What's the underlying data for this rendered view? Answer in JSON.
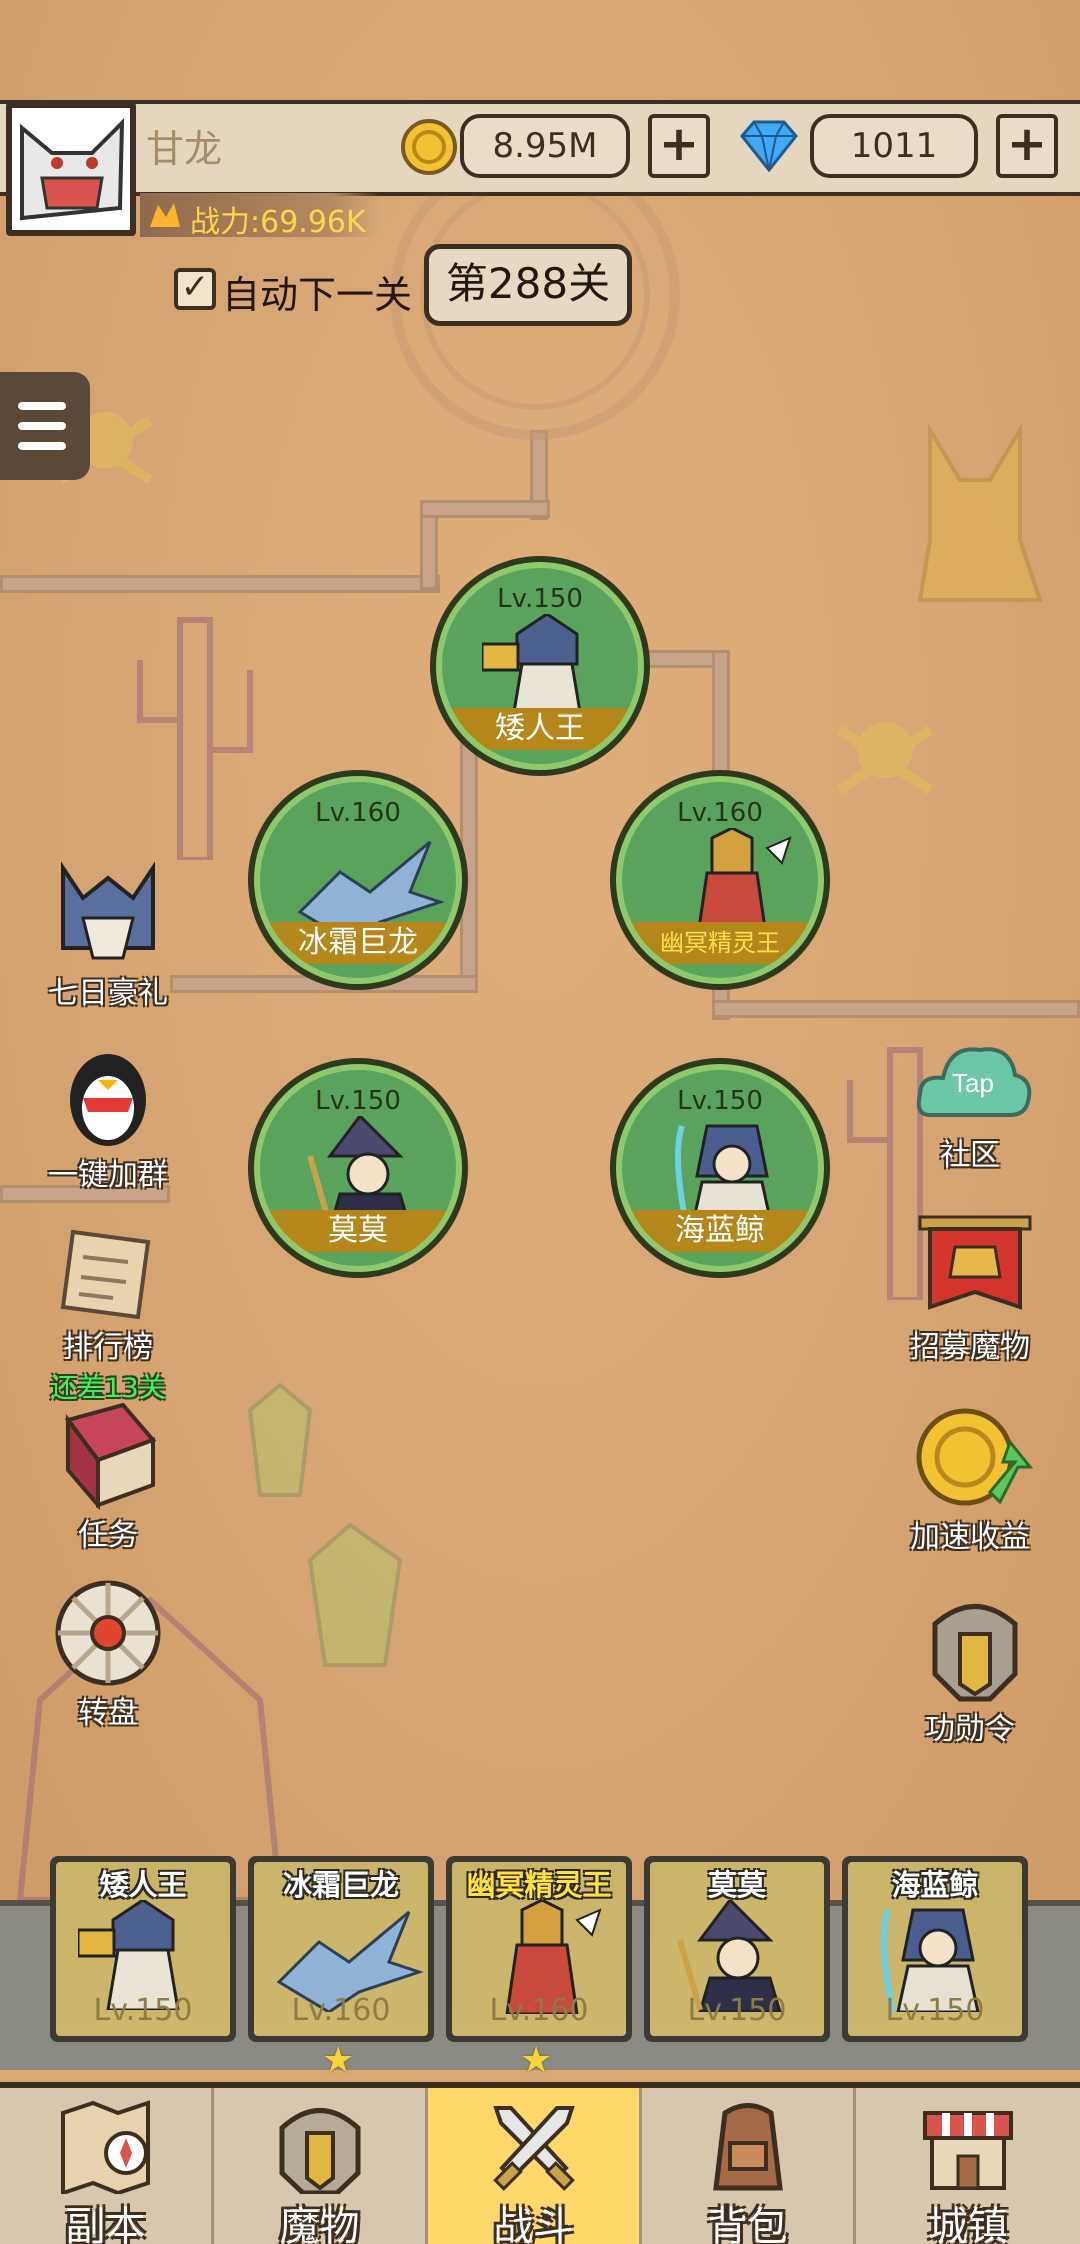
{
  "player": {
    "name": "甘龙",
    "power_label": "战力:69.96K"
  },
  "currency": {
    "gold": "8.95M",
    "gems": "1011",
    "add_symbol": "+"
  },
  "stage": {
    "auto_next_label": "自动下一关",
    "auto_next_checked": true,
    "check_mark": "✓",
    "current_stage": "第288关"
  },
  "formation": [
    {
      "level": "Lv.150",
      "name": "矮人王"
    },
    {
      "level": "Lv.160",
      "name": "冰霜巨龙"
    },
    {
      "level": "Lv.160",
      "name": "幽冥精灵王"
    },
    {
      "level": "Lv.150",
      "name": "莫莫"
    },
    {
      "level": "Lv.150",
      "name": "海蓝鲸"
    }
  ],
  "left_menu": [
    {
      "label": "七日豪礼",
      "icon": "knight-helmet-icon"
    },
    {
      "label": "一键加群",
      "icon": "penguin-icon"
    },
    {
      "label": "排行榜",
      "sub": "还差13关",
      "icon": "scroll-icon"
    },
    {
      "label": "任务",
      "icon": "book-icon"
    },
    {
      "label": "转盘",
      "icon": "wheel-icon"
    }
  ],
  "right_menu": [
    {
      "label": "社区",
      "icon": "tap-cloud-icon",
      "badge": "Tap"
    },
    {
      "label": "招募魔物",
      "icon": "banner-helmet-icon"
    },
    {
      "label": "加速收益",
      "icon": "coin-arrow-icon"
    },
    {
      "label": "功勋令",
      "icon": "gold-helmet-icon"
    }
  ],
  "squad": [
    {
      "name": "矮人王",
      "level": "Lv.150",
      "starred": false
    },
    {
      "name": "冰霜巨龙",
      "level": "Lv.160",
      "starred": true
    },
    {
      "name": "幽冥精灵王",
      "level": "Lv.160",
      "starred": true
    },
    {
      "name": "莫莫",
      "level": "Lv.150",
      "starred": false
    },
    {
      "name": "海蓝鲸",
      "level": "Lv.150",
      "starred": false
    }
  ],
  "star_glyph": "★",
  "tabs": [
    {
      "label": "副本",
      "icon": "map-compass-icon",
      "active": false
    },
    {
      "label": "魔物",
      "icon": "monster-helmet-icon",
      "active": false
    },
    {
      "label": "战斗",
      "icon": "crossed-swords-icon",
      "active": true
    },
    {
      "label": "背包",
      "icon": "backpack-icon",
      "active": false
    },
    {
      "label": "城镇",
      "icon": "shop-icon",
      "active": false
    }
  ],
  "colors": {
    "map_bg": "#d9a875",
    "node_green": "#5aa35c",
    "name_band": "#b5871a",
    "active_tab": "#ffd76b",
    "green_text": "#3df25a"
  }
}
